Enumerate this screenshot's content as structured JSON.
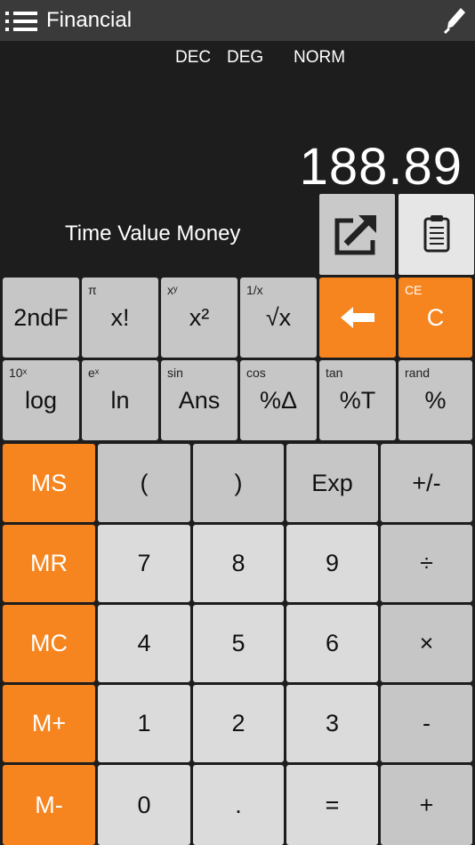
{
  "header": {
    "title": "Financial",
    "menu_icon": "list-menu-icon",
    "edit_icon": "pen-icon"
  },
  "status": {
    "base": "DEC",
    "angle": "DEG",
    "notation": "NORM"
  },
  "display": {
    "value": "188.89",
    "function_title": "Time Value Money"
  },
  "actions": {
    "share_icon": "share-icon",
    "clipboard_icon": "clipboard-icon"
  },
  "colors": {
    "accent": "#f6851f",
    "topbar": "#3a3a3a",
    "background": "#1d1d1d",
    "key_gray": "#c6c6c6",
    "key_light": "#dbdbdb"
  },
  "sci_keys": [
    {
      "label": "2ndF",
      "sup": ""
    },
    {
      "label": "x!",
      "sup": "π"
    },
    {
      "label": "x²",
      "sup": "xʸ"
    },
    {
      "label": "√x",
      "sup": "1/x"
    },
    {
      "label": "⬅",
      "sup": ""
    },
    {
      "label": "C",
      "sup": "CE"
    },
    {
      "label": "log",
      "sup": "10ˣ"
    },
    {
      "label": "ln",
      "sup": "eˣ"
    },
    {
      "label": "Ans",
      "sup": "sin"
    },
    {
      "label": "%Δ",
      "sup": "cos"
    },
    {
      "label": "%T",
      "sup": "tan"
    },
    {
      "label": "%",
      "sup": "rand"
    }
  ],
  "memory_keys": [
    "MS",
    "MR",
    "MC",
    "M+",
    "M-"
  ],
  "pad_keys": [
    [
      "(",
      ")",
      "Exp",
      "+/-"
    ],
    [
      "7",
      "8",
      "9",
      "÷"
    ],
    [
      "4",
      "5",
      "6",
      "×"
    ],
    [
      "1",
      "2",
      "3",
      "-"
    ],
    [
      "0",
      ".",
      "=",
      "+"
    ]
  ]
}
